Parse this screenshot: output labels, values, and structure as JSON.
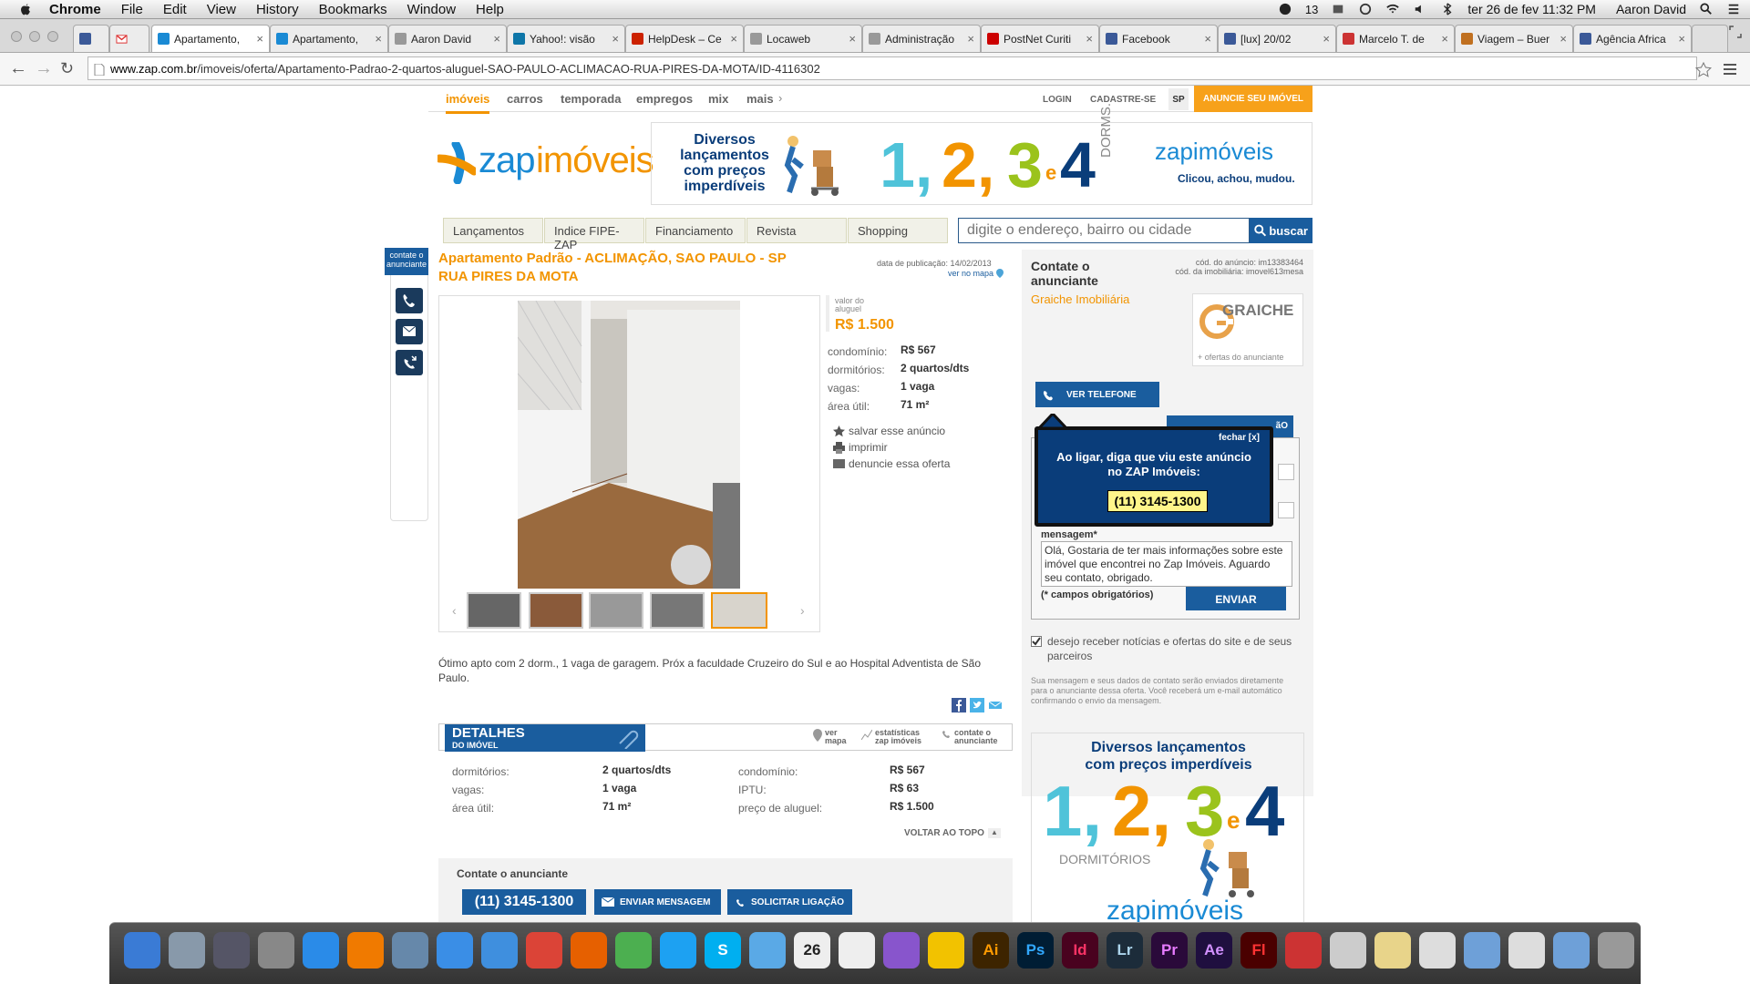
{
  "menubar": {
    "app": "Chrome",
    "items": [
      "File",
      "Edit",
      "View",
      "History",
      "Bookmarks",
      "Window",
      "Help"
    ],
    "badge_count": "13",
    "clock": "ter 26 de fev  11:32 PM",
    "user": "Aaron David"
  },
  "tabs": [
    {
      "title": "Apartamento,",
      "active": true,
      "color": "#1a8ad4"
    },
    {
      "title": "Apartamento,",
      "active": false,
      "color": "#1a8ad4"
    },
    {
      "title": "Aaron David",
      "active": false,
      "color": "#999999"
    },
    {
      "title": "Yahoo!: visão",
      "active": false,
      "color": "#0e76a8"
    },
    {
      "title": "HelpDesk – Ce",
      "active": false,
      "color": "#cc2200"
    },
    {
      "title": "Locaweb",
      "active": false,
      "color": "#999999"
    },
    {
      "title": "Administração",
      "active": false,
      "color": "#999999"
    },
    {
      "title": "PostNet Curiti",
      "active": false,
      "color": "#cc0000"
    },
    {
      "title": "Facebook",
      "active": false,
      "color": "#3b5998"
    },
    {
      "title": "[lux] 20/02",
      "active": false,
      "color": "#3b5998"
    },
    {
      "title": "Marcelo T. de",
      "active": false,
      "color": "#cc3333"
    },
    {
      "title": "Viagem – Buer",
      "active": false,
      "color": "#c07020"
    },
    {
      "title": "Agência Africa",
      "active": false,
      "color": "#3b5998"
    }
  ],
  "address": {
    "domain": "www.zap.com.br",
    "path": "/imoveis/oferta/Apartamento-Padrao-2-quartos-aluguel-SAO-PAULO-ACLIMACAO-RUA-PIRES-DA-MOTA/ID-4116302"
  },
  "site": {
    "nav": [
      "imóveis",
      "carros",
      "temporada",
      "empregos",
      "mix",
      "mais"
    ],
    "login": "LOGIN",
    "cadastre": "CADASTRE-SE",
    "state": "SP",
    "anuncie": "ANUNCIE SEU IMÓVEL",
    "logo": {
      "zap": "zap",
      "imoveis": "imóveis"
    },
    "banner": {
      "text1": "Diversos",
      "text2": "lançamentos",
      "text3": "com preços",
      "text4": "imperdíveis",
      "n1": "1,",
      "n2": "2,",
      "n3": "3",
      "e": "e",
      "n4": "4",
      "dorms": "DORMS.",
      "brand": "zapimóveis",
      "slogan": "Clicou, achou, mudou."
    },
    "sections": [
      "Lançamentos",
      "Indice FIPE-ZAP",
      "Financiamento",
      "Revista",
      "Shopping"
    ],
    "search": {
      "placeholder": "digite o endereço, bairro ou cidade",
      "button": "buscar"
    }
  },
  "listing": {
    "title1": "Apartamento Padrão - ACLIMAÇÃO, SAO PAULO - SP",
    "title2": "RUA PIRES DA MOTA",
    "pub_date": "data de publicação: 14/02/2013",
    "ver_mapa": "ver no mapa",
    "valor_label1": "valor do",
    "valor_label2": "aluguel",
    "price": "R$ 1.500",
    "facts": [
      {
        "label": "condomínio:",
        "value": "R$ 567"
      },
      {
        "label": "dormitórios:",
        "value": "2 quartos/dts"
      },
      {
        "label": "vagas:",
        "value": "1 vaga"
      },
      {
        "label": "área útil:",
        "value": "71 m²"
      }
    ],
    "actions": [
      "salvar esse anúncio",
      "imprimir",
      "denuncie essa oferta"
    ],
    "description": "Ótimo apto com 2 dorm., 1 vaga de garagem. Próx a faculdade Cruzeiro do Sul e ao Hospital Adventista de São Paulo.",
    "side_contact": "contate o anunciante"
  },
  "details": {
    "heading": "DETALHES",
    "sub": "DO IMÓVEL",
    "links": [
      "ver mapa",
      "estatísticas zap imóveis",
      "contate o anunciante"
    ],
    "left": [
      {
        "label": "dormitórios:",
        "value": "2 quartos/dts"
      },
      {
        "label": "vagas:",
        "value": "1 vaga"
      },
      {
        "label": "área útil:",
        "value": "71 m²"
      }
    ],
    "right": [
      {
        "label": "condomínio:",
        "value": "R$ 567"
      },
      {
        "label": "IPTU:",
        "value": "R$ 63"
      },
      {
        "label": "preço de aluguel:",
        "value": "R$ 1.500"
      }
    ],
    "voltar": "VOLTAR AO TOPO"
  },
  "bottom_contact": {
    "title": "Contate o anunciante",
    "phone": "(11) 3145-1300",
    "msg": "ENVIAR MENSAGEM",
    "call": "SOLICITAR LIGAÇÃO"
  },
  "contact": {
    "title1": "Contate o",
    "title2": "anunciante",
    "cod1": "cód. do anúncio: im13383464",
    "cod2": "cód. da imobiliária: imovel613mesa",
    "agency": "Graiche Imobiliária",
    "agency_logo": "GRAICHE",
    "mais_ofertas": "+ ofertas do anunciante",
    "ver_telefone": "VER TELEFONE",
    "popup_close": "fechar [x]",
    "popup_text1": "Ao ligar, diga que viu este anúncio",
    "popup_text2": "no ",
    "popup_bold": "ZAP Imóveis:",
    "popup_phone": "(11) 3145-1300",
    "msg_label": "mensagem*",
    "msg_value": "Olá, Gostaria de ter mais informações sobre este imóvel que encontrei no Zap Imóveis. Aguardo seu contato, obrigado.",
    "required": "(* campos obrigatórios)",
    "enviar": "ENVIAR",
    "optin": "desejo receber notícias e ofertas do site e de seus parceiros",
    "disclaimer": "Sua mensagem e seus dados de contato serão enviados diretamente para o anunciante dessa oferta. Você receberá um e-mail automático confirmando o envio da mensagem."
  },
  "ad2": {
    "line1": "Diversos lançamentos",
    "line2": "com preços imperdíveis",
    "n1": "1,",
    "n2": "2,",
    "n3": "3",
    "e": "e",
    "n4": "4",
    "dorm": "DORMITÓRIOS",
    "brand": "zapimóveis"
  },
  "dock": {
    "calendar_day": "26",
    "apps": [
      {
        "name": "finder",
        "color": "#3a7bd5",
        "label": ""
      },
      {
        "name": "launchpad",
        "color": "#8899aa",
        "label": ""
      },
      {
        "name": "photo",
        "color": "#556",
        "label": ""
      },
      {
        "name": "settings",
        "color": "#888",
        "label": ""
      },
      {
        "name": "appstore",
        "color": "#2a8be8",
        "label": ""
      },
      {
        "name": "vlc",
        "color": "#f07a00",
        "label": ""
      },
      {
        "name": "preview",
        "color": "#6688aa",
        "label": ""
      },
      {
        "name": "itunes",
        "color": "#3a8ee6",
        "label": ""
      },
      {
        "name": "safari",
        "color": "#3f8fde",
        "label": ""
      },
      {
        "name": "chrome",
        "color": "#db4437",
        "label": ""
      },
      {
        "name": "firefox",
        "color": "#e66000",
        "label": ""
      },
      {
        "name": "adium",
        "color": "#4caf50",
        "label": ""
      },
      {
        "name": "twitter",
        "color": "#1da1f2",
        "label": ""
      },
      {
        "name": "skype",
        "color": "#00aff0",
        "label": "S"
      },
      {
        "name": "messages",
        "color": "#5aa9e6",
        "label": ""
      },
      {
        "name": "calendar",
        "color": "#eeeeee",
        "label": ""
      },
      {
        "name": "reminders",
        "color": "#eeeeee",
        "label": ""
      },
      {
        "name": "xtorrent",
        "color": "#8855cc",
        "label": ""
      },
      {
        "name": "cyberduck",
        "color": "#f2c200",
        "label": ""
      },
      {
        "name": "illustrator",
        "color": "#3d2400",
        "label": "Ai"
      },
      {
        "name": "photoshop",
        "color": "#001d34",
        "label": "Ps"
      },
      {
        "name": "indesign",
        "color": "#49021f",
        "label": "Id"
      },
      {
        "name": "lightroom",
        "color": "#1c2c3a",
        "label": "Lr"
      },
      {
        "name": "premiere",
        "color": "#2a0a3a",
        "label": "Pr"
      },
      {
        "name": "aftereffects",
        "color": "#1f0f3f",
        "label": "Ae"
      },
      {
        "name": "flash",
        "color": "#4a0000",
        "label": "Fl"
      },
      {
        "name": "flashcard",
        "color": "#cc3333",
        "label": ""
      },
      {
        "name": "rings",
        "color": "#cccccc",
        "label": ""
      },
      {
        "name": "stickies",
        "color": "#e8d48a",
        "label": ""
      },
      {
        "name": "document",
        "color": "#dddddd",
        "label": ""
      },
      {
        "name": "folder",
        "color": "#6ea0d8",
        "label": ""
      },
      {
        "name": "files",
        "color": "#dddddd",
        "label": ""
      },
      {
        "name": "downloads",
        "color": "#6ea0d8",
        "label": ""
      },
      {
        "name": "trash",
        "color": "#999999",
        "label": ""
      }
    ]
  }
}
